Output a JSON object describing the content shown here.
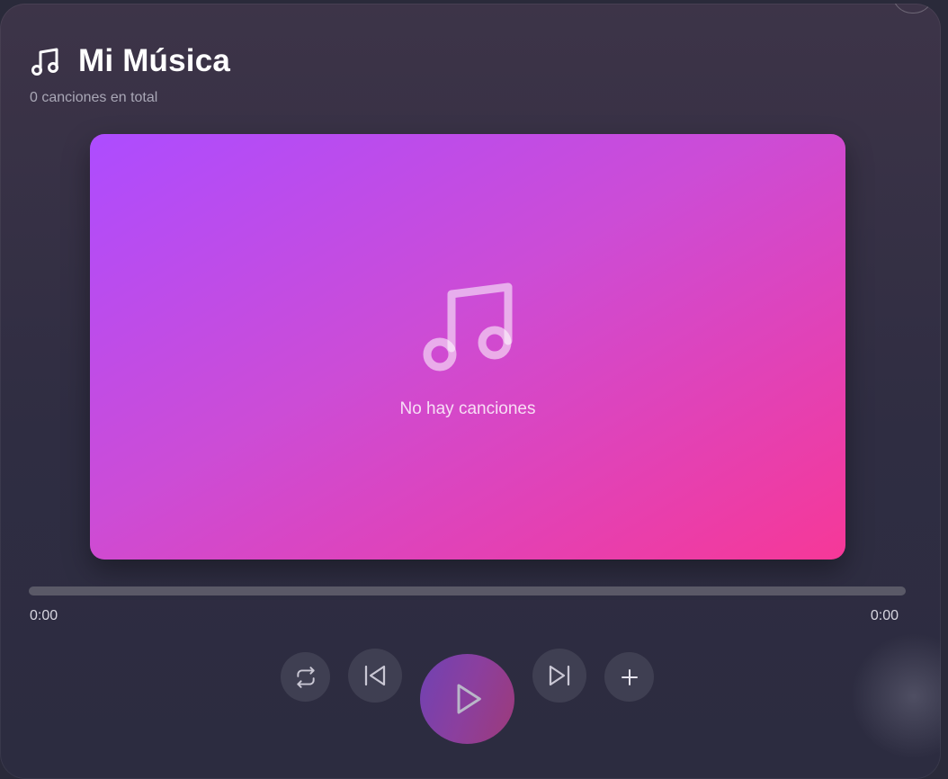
{
  "header": {
    "icon": "music-note-icon",
    "title": "Mi Música",
    "subtitle": "0 canciones en total"
  },
  "artwork": {
    "icon": "music-note-icon",
    "empty_text": "No hay canciones",
    "gradient_colors": [
      "#ad4cff",
      "#cc4cd6",
      "#f63898"
    ]
  },
  "progress": {
    "fraction": 0,
    "current_time": "0:00",
    "total_time": "0:00"
  },
  "controls": {
    "repeat_icon": "repeat-icon",
    "previous_icon": "skip-previous-icon",
    "play_icon": "play-icon",
    "next_icon": "skip-next-icon",
    "add_icon": "plus-icon"
  },
  "colors": {
    "background": "#2f2d42",
    "accent_play_start": "#7042b3",
    "accent_play_end": "#9d3a79"
  }
}
